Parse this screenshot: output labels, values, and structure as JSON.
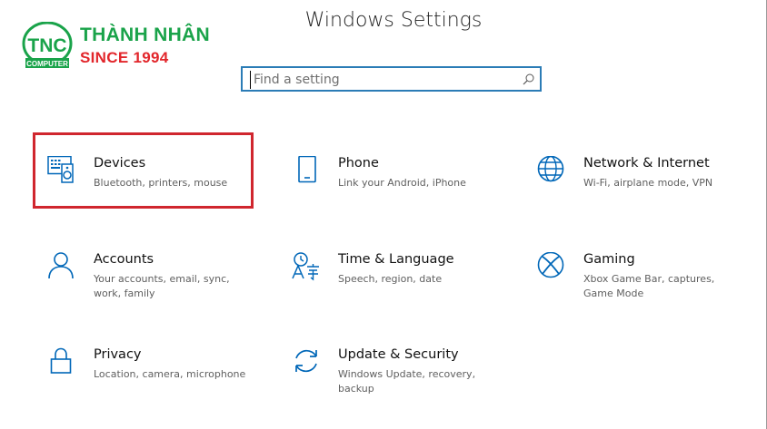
{
  "logo": {
    "monogram": "TNC",
    "sub": "COMPUTER",
    "brand": "THÀNH NHÂN",
    "since": "SINCE 1994",
    "colors": {
      "green": "#1aa34a",
      "red": "#e2262b"
    }
  },
  "window": {
    "title": "Windows Settings"
  },
  "search": {
    "placeholder": "Find a setting",
    "icon": "search-icon"
  },
  "accent": "#0067b8",
  "highlight_color": "#d0262e",
  "tiles": [
    {
      "title": "Devices",
      "desc": "Bluetooth, printers, mouse",
      "icon": "devices-icon"
    },
    {
      "title": "Phone",
      "desc": "Link your Android, iPhone",
      "icon": "phone-icon"
    },
    {
      "title": "Network & Internet",
      "desc": "Wi-Fi, airplane mode, VPN",
      "icon": "globe-icon"
    },
    {
      "title": "Accounts",
      "desc": "Your accounts, email, sync, work, family",
      "icon": "person-icon"
    },
    {
      "title": "Time & Language",
      "desc": "Speech, region, date",
      "icon": "time-language-icon"
    },
    {
      "title": "Gaming",
      "desc": "Xbox Game Bar, captures, Game Mode",
      "icon": "xbox-icon"
    },
    {
      "title": "Privacy",
      "desc": "Location, camera, microphone",
      "icon": "lock-icon"
    },
    {
      "title": "Update & Security",
      "desc": "Windows Update, recovery, backup",
      "icon": "sync-icon"
    }
  ]
}
